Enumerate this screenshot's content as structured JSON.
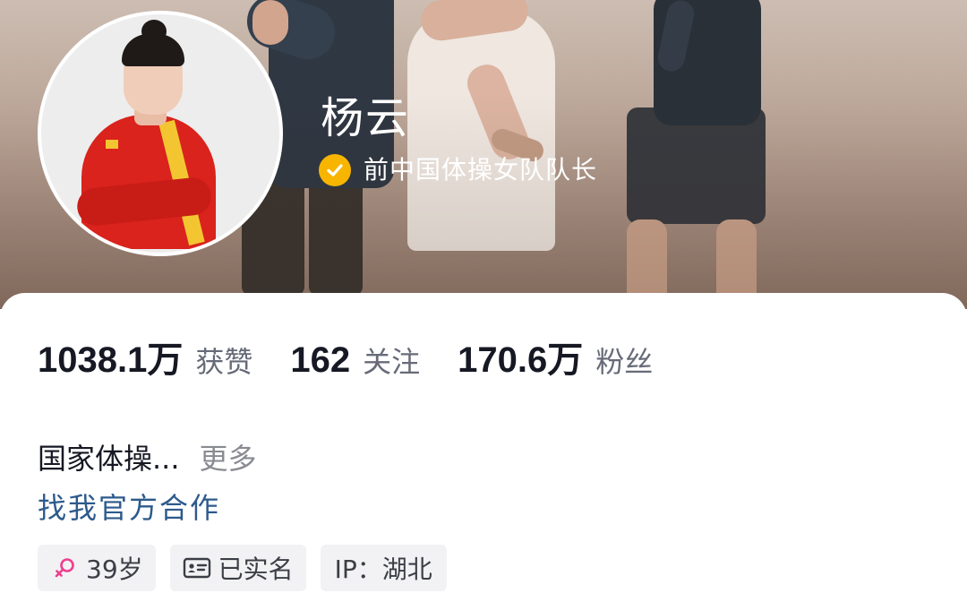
{
  "profile": {
    "name": "杨云",
    "certification": "前中国体操女队队长"
  },
  "stats": [
    {
      "value": "1038.1万",
      "label": "获赞"
    },
    {
      "value": "162",
      "label": "关注"
    },
    {
      "value": "170.6万",
      "label": "粉丝"
    }
  ],
  "bio": {
    "text": "国家体操...",
    "more_label": "更多"
  },
  "cooperation_link": "找我官方合作",
  "tags": {
    "age": "39岁",
    "verified": "已实名",
    "ip": "IP：湖北"
  },
  "icons": {
    "verified_badge": "check-circle-icon",
    "gender": "female-icon",
    "id_card": "id-card-icon"
  },
  "colors": {
    "verified_badge": "#f7b500",
    "female_symbol": "#ef3e8f",
    "link": "#2d5a8c",
    "number": "#161823",
    "label": "#676b78"
  }
}
